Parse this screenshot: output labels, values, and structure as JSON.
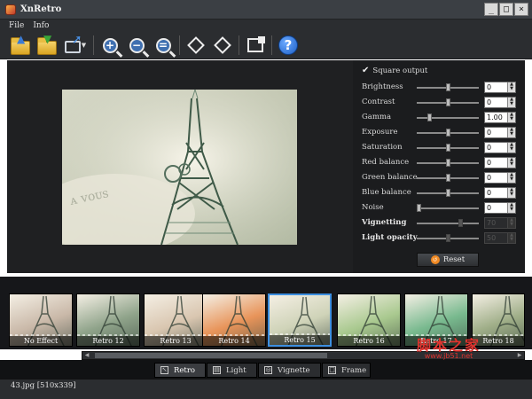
{
  "window": {
    "title": "XnRetro"
  },
  "menu": [
    {
      "label": "File"
    },
    {
      "label": "Info"
    }
  ],
  "toolbar": {
    "icons": [
      "open-folder-icon",
      "save-folder-icon",
      "export-icon",
      "zoom-in-icon",
      "zoom-out-icon",
      "zoom-fit-icon",
      "rotate-left-icon",
      "rotate-right-icon",
      "fit-window-icon",
      "help-icon"
    ]
  },
  "settings": {
    "square_output_label": "Square output",
    "square_output_checked": true,
    "sliders": [
      {
        "label": "Brightness",
        "value": "0",
        "position": 0.5,
        "enabled": true
      },
      {
        "label": "Contrast",
        "value": "0",
        "position": 0.5,
        "enabled": true
      },
      {
        "label": "Gamma",
        "value": "1.00",
        "position": 0.2,
        "enabled": true
      },
      {
        "label": "Exposure",
        "value": "0",
        "position": 0.5,
        "enabled": true
      },
      {
        "label": "Saturation",
        "value": "0",
        "position": 0.5,
        "enabled": true
      },
      {
        "label": "Red balance",
        "value": "0",
        "position": 0.5,
        "enabled": true
      },
      {
        "label": "Green balance",
        "value": "0",
        "position": 0.5,
        "enabled": true
      },
      {
        "label": "Blue balance",
        "value": "0",
        "position": 0.5,
        "enabled": true
      },
      {
        "label": "Noise",
        "value": "0",
        "position": 0.03,
        "enabled": true
      },
      {
        "label": "Vignetting",
        "value": "70",
        "position": 0.7,
        "enabled": false
      },
      {
        "label": "Light opacity",
        "value": "50",
        "position": 0.5,
        "enabled": false
      }
    ],
    "reset_label": "Reset"
  },
  "filmstrip": {
    "thumbnails": [
      {
        "label": "No Effect",
        "selected": false,
        "tint": "#c9b8a8"
      },
      {
        "label": "Retro 12",
        "selected": false,
        "tint": "#8fa38a"
      },
      {
        "label": "Retro 13",
        "selected": false,
        "tint": "#d9c6b0"
      },
      {
        "label": "Retro 14",
        "selected": false,
        "tint": "#e8945a"
      },
      {
        "label": "Retro 15",
        "selected": true,
        "tint": "#cfd3b8"
      },
      {
        "label": "Retro 16",
        "selected": false,
        "tint": "#a9c98f"
      },
      {
        "label": "Retro 17",
        "selected": false,
        "tint": "#78b98e"
      },
      {
        "label": "Retro 18",
        "selected": false,
        "tint": "#9fae88"
      }
    ]
  },
  "tabs": [
    {
      "label": "Retro",
      "icon": "retro-tab-icon",
      "active": true
    },
    {
      "label": "Light",
      "icon": "light-tab-icon",
      "active": false
    },
    {
      "label": "Vignette",
      "icon": "vignette-tab-icon",
      "active": false
    },
    {
      "label": "Frame",
      "icon": "frame-tab-icon",
      "active": false
    }
  ],
  "status": {
    "text": "43.jpg [510x339]"
  },
  "watermark": {
    "text": "脚本之家",
    "url": "www.jb51.net"
  },
  "colors": {
    "selection": "#3d8fe0",
    "accent_orange": "#f08a24"
  }
}
